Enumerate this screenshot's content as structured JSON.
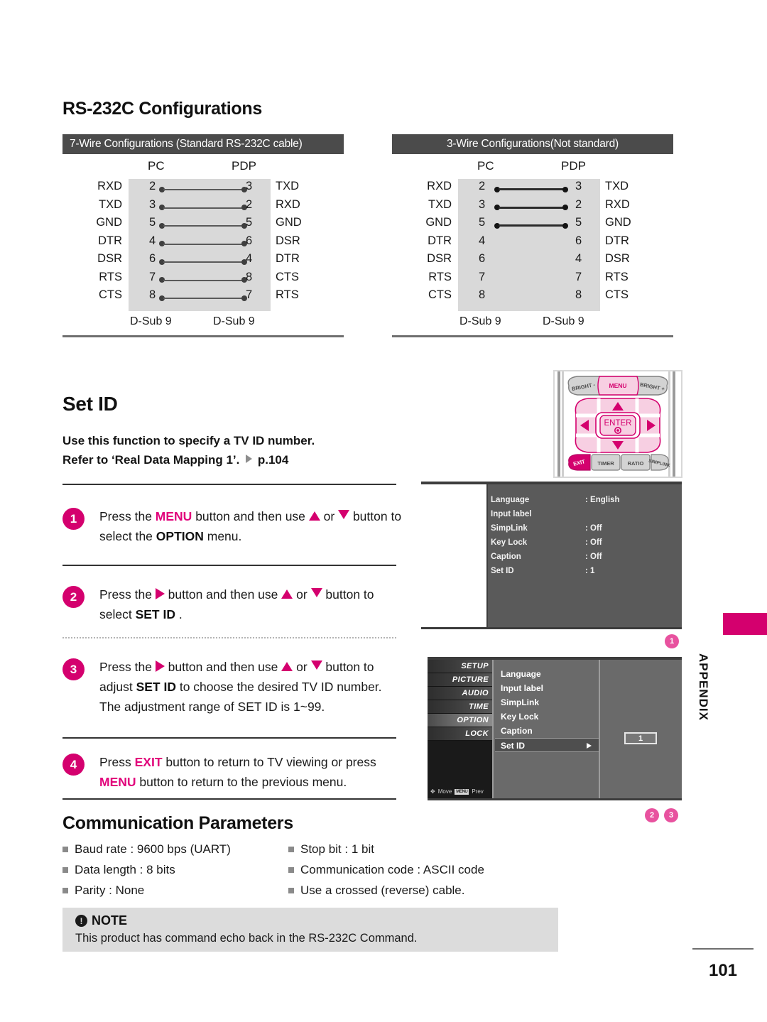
{
  "headings": {
    "rs232c": "RS-232C Configurations",
    "set_id": "Set ID",
    "comm_params": "Communication Parameters"
  },
  "wire_configs": [
    {
      "id": "7-wire",
      "header": "7-Wire Configurations (Standard RS-232C cable)",
      "col_left": "PC",
      "col_right": "PDP",
      "connector_left": "D-Sub 9",
      "connector_right": "D-Sub 9",
      "rows": [
        {
          "signal_left": "RXD",
          "pin_left": "2",
          "pin_right": "3",
          "signal_right": "TXD",
          "linked": true
        },
        {
          "signal_left": "TXD",
          "pin_left": "3",
          "pin_right": "2",
          "signal_right": "RXD",
          "linked": true
        },
        {
          "signal_left": "GND",
          "pin_left": "5",
          "pin_right": "5",
          "signal_right": "GND",
          "linked": true
        },
        {
          "signal_left": "DTR",
          "pin_left": "4",
          "pin_right": "6",
          "signal_right": "DSR",
          "linked": true
        },
        {
          "signal_left": "DSR",
          "pin_left": "6",
          "pin_right": "4",
          "signal_right": "DTR",
          "linked": true
        },
        {
          "signal_left": "RTS",
          "pin_left": "7",
          "pin_right": "8",
          "signal_right": "CTS",
          "linked": true
        },
        {
          "signal_left": "CTS",
          "pin_left": "8",
          "pin_right": "7",
          "signal_right": "RTS",
          "linked": true
        }
      ]
    },
    {
      "id": "3-wire",
      "header": "3-Wire Configurations(Not standard)",
      "col_left": "PC",
      "col_right": "PDP",
      "connector_left": "D-Sub 9",
      "connector_right": "D-Sub 9",
      "rows": [
        {
          "signal_left": "RXD",
          "pin_left": "2",
          "pin_right": "3",
          "signal_right": "TXD",
          "linked": true
        },
        {
          "signal_left": "TXD",
          "pin_left": "3",
          "pin_right": "2",
          "signal_right": "RXD",
          "linked": true
        },
        {
          "signal_left": "GND",
          "pin_left": "5",
          "pin_right": "5",
          "signal_right": "GND",
          "linked": true
        },
        {
          "signal_left": "DTR",
          "pin_left": "4",
          "pin_right": "6",
          "signal_right": "DTR",
          "linked": false
        },
        {
          "signal_left": "DSR",
          "pin_left": "6",
          "pin_right": "4",
          "signal_right": "DSR",
          "linked": false
        },
        {
          "signal_left": "RTS",
          "pin_left": "7",
          "pin_right": "7",
          "signal_right": "RTS",
          "linked": false
        },
        {
          "signal_left": "CTS",
          "pin_left": "8",
          "pin_right": "8",
          "signal_right": "CTS",
          "linked": false
        }
      ]
    }
  ],
  "set_id": {
    "intro_line1": "Use this function to specify a TV ID number.",
    "intro_line2_a": "Refer to ‘Real Data Mapping 1’.",
    "intro_line2_b": "p.104"
  },
  "steps": [
    {
      "number": "1",
      "parts": [
        {
          "t": "Press the ",
          "s": "plain"
        },
        {
          "t": "MENU",
          "s": "magenta"
        },
        {
          "t": " button and then use ",
          "s": "plain"
        },
        {
          "t": "▲",
          "s": "tri-up"
        },
        {
          "t": " or ",
          "s": "plain"
        },
        {
          "t": "▼",
          "s": "tri-dn"
        },
        {
          "t": " button to select the ",
          "s": "plain"
        },
        {
          "t": "OPTION",
          "s": "bold"
        },
        {
          "t": "  menu.",
          "s": "plain"
        }
      ]
    },
    {
      "number": "2",
      "parts": [
        {
          "t": "Press the ",
          "s": "plain"
        },
        {
          "t": "▶",
          "s": "tri-rt"
        },
        {
          "t": " button and then use ",
          "s": "plain"
        },
        {
          "t": "▲",
          "s": "tri-up"
        },
        {
          "t": " or ",
          "s": "plain"
        },
        {
          "t": "▼",
          "s": "tri-dn"
        },
        {
          "t": " button to select ",
          "s": "plain"
        },
        {
          "t": "SET ID",
          "s": "bold"
        },
        {
          "t": " .",
          "s": "plain"
        }
      ]
    },
    {
      "number": "3",
      "parts": [
        {
          "t": "Press the ",
          "s": "plain"
        },
        {
          "t": "▶",
          "s": "tri-rt"
        },
        {
          "t": " button and then use ",
          "s": "plain"
        },
        {
          "t": "▲",
          "s": "tri-up"
        },
        {
          "t": " or ",
          "s": "plain"
        },
        {
          "t": "▼",
          "s": "tri-dn"
        },
        {
          "t": " button to adjust ",
          "s": "plain"
        },
        {
          "t": "SET ID",
          "s": "bold"
        },
        {
          "t": "  to choose the desired TV ID number. The adjustment range of SET ID is 1~99.",
          "s": "plain"
        }
      ]
    },
    {
      "number": "4",
      "parts": [
        {
          "t": "Press ",
          "s": "plain"
        },
        {
          "t": "EXIT",
          "s": "magenta"
        },
        {
          "t": " button to return to TV viewing or press ",
          "s": "plain"
        },
        {
          "t": "MENU",
          "s": "magenta"
        },
        {
          "t": " button to return to the previous menu.",
          "s": "plain"
        }
      ]
    }
  ],
  "remote": {
    "menu": "MENU",
    "bright_minus": "BRIGHT -",
    "bright_plus": "BRIGHT +",
    "enter": "ENTER",
    "exit": "EXIT",
    "timer": "TIMER",
    "ratio": "RATIO",
    "simplink": "SIMPLINK"
  },
  "osd_1": {
    "rows": [
      {
        "label": "Language",
        "value": ": English"
      },
      {
        "label": "Input label",
        "value": ""
      },
      {
        "label": "SimpLink",
        "value": ": Off"
      },
      {
        "label": "Key Lock",
        "value": ": Off"
      },
      {
        "label": "Caption",
        "value": ": Off"
      },
      {
        "label": "Set ID",
        "value": ": 1"
      }
    ]
  },
  "osd_2": {
    "nav": [
      {
        "label": "SETUP",
        "selected": false
      },
      {
        "label": "PICTURE",
        "selected": false
      },
      {
        "label": "AUDIO",
        "selected": false
      },
      {
        "label": "TIME",
        "selected": false
      },
      {
        "label": "OPTION",
        "selected": true
      },
      {
        "label": "LOCK",
        "selected": false
      }
    ],
    "hint_move": "Move",
    "hint_prev_key": "MENU",
    "hint_prev": "Prev",
    "items": [
      {
        "label": "Language",
        "selected": false
      },
      {
        "label": "Input label",
        "selected": false
      },
      {
        "label": "SimpLink",
        "selected": false
      },
      {
        "label": "Key Lock",
        "selected": false
      },
      {
        "label": "Caption",
        "selected": false
      },
      {
        "label": "Set ID",
        "selected": true
      }
    ],
    "value": "1"
  },
  "markers": {
    "m1": "1",
    "m2": "2",
    "m3": "3"
  },
  "comm_params": {
    "left": [
      "Baud rate : 9600 bps (UART)",
      "Data length : 8 bits",
      "Parity : None"
    ],
    "right": [
      "Stop bit : 1 bit",
      "Communication code : ASCII code",
      "Use a crossed (reverse) cable."
    ]
  },
  "note": {
    "title": "NOTE",
    "body": "This product has command echo back in the RS-232C Command."
  },
  "appendix": {
    "label": "APPENDIX"
  },
  "page": {
    "number": "101"
  },
  "colors": {
    "accent_magenta": "#d4006e",
    "header_bar": "#4b4b4b",
    "shade": "#d9d9d9",
    "note_bg": "#dcdcdc"
  }
}
